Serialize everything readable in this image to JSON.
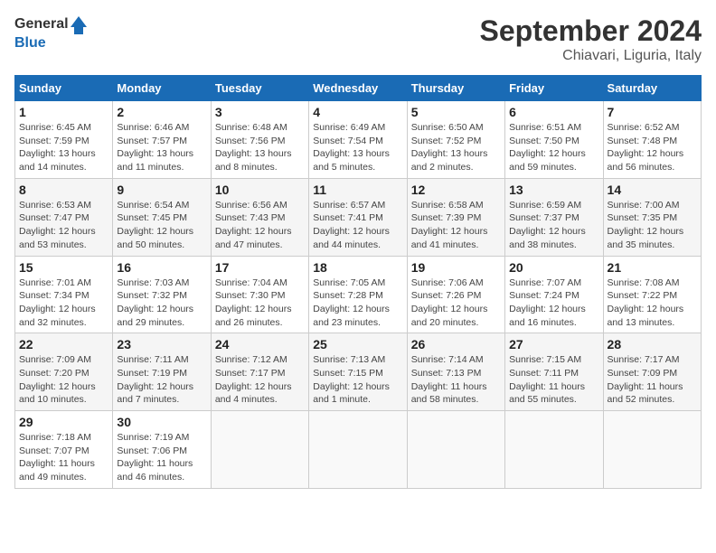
{
  "logo": {
    "line1": "General",
    "line2": "Blue"
  },
  "title": "September 2024",
  "location": "Chiavari, Liguria, Italy",
  "weekdays": [
    "Sunday",
    "Monday",
    "Tuesday",
    "Wednesday",
    "Thursday",
    "Friday",
    "Saturday"
  ],
  "weeks": [
    [
      {
        "day": "1",
        "info": "Sunrise: 6:45 AM\nSunset: 7:59 PM\nDaylight: 13 hours\nand 14 minutes."
      },
      {
        "day": "2",
        "info": "Sunrise: 6:46 AM\nSunset: 7:57 PM\nDaylight: 13 hours\nand 11 minutes."
      },
      {
        "day": "3",
        "info": "Sunrise: 6:48 AM\nSunset: 7:56 PM\nDaylight: 13 hours\nand 8 minutes."
      },
      {
        "day": "4",
        "info": "Sunrise: 6:49 AM\nSunset: 7:54 PM\nDaylight: 13 hours\nand 5 minutes."
      },
      {
        "day": "5",
        "info": "Sunrise: 6:50 AM\nSunset: 7:52 PM\nDaylight: 13 hours\nand 2 minutes."
      },
      {
        "day": "6",
        "info": "Sunrise: 6:51 AM\nSunset: 7:50 PM\nDaylight: 12 hours\nand 59 minutes."
      },
      {
        "day": "7",
        "info": "Sunrise: 6:52 AM\nSunset: 7:48 PM\nDaylight: 12 hours\nand 56 minutes."
      }
    ],
    [
      {
        "day": "8",
        "info": "Sunrise: 6:53 AM\nSunset: 7:47 PM\nDaylight: 12 hours\nand 53 minutes."
      },
      {
        "day": "9",
        "info": "Sunrise: 6:54 AM\nSunset: 7:45 PM\nDaylight: 12 hours\nand 50 minutes."
      },
      {
        "day": "10",
        "info": "Sunrise: 6:56 AM\nSunset: 7:43 PM\nDaylight: 12 hours\nand 47 minutes."
      },
      {
        "day": "11",
        "info": "Sunrise: 6:57 AM\nSunset: 7:41 PM\nDaylight: 12 hours\nand 44 minutes."
      },
      {
        "day": "12",
        "info": "Sunrise: 6:58 AM\nSunset: 7:39 PM\nDaylight: 12 hours\nand 41 minutes."
      },
      {
        "day": "13",
        "info": "Sunrise: 6:59 AM\nSunset: 7:37 PM\nDaylight: 12 hours\nand 38 minutes."
      },
      {
        "day": "14",
        "info": "Sunrise: 7:00 AM\nSunset: 7:35 PM\nDaylight: 12 hours\nand 35 minutes."
      }
    ],
    [
      {
        "day": "15",
        "info": "Sunrise: 7:01 AM\nSunset: 7:34 PM\nDaylight: 12 hours\nand 32 minutes."
      },
      {
        "day": "16",
        "info": "Sunrise: 7:03 AM\nSunset: 7:32 PM\nDaylight: 12 hours\nand 29 minutes."
      },
      {
        "day": "17",
        "info": "Sunrise: 7:04 AM\nSunset: 7:30 PM\nDaylight: 12 hours\nand 26 minutes."
      },
      {
        "day": "18",
        "info": "Sunrise: 7:05 AM\nSunset: 7:28 PM\nDaylight: 12 hours\nand 23 minutes."
      },
      {
        "day": "19",
        "info": "Sunrise: 7:06 AM\nSunset: 7:26 PM\nDaylight: 12 hours\nand 20 minutes."
      },
      {
        "day": "20",
        "info": "Sunrise: 7:07 AM\nSunset: 7:24 PM\nDaylight: 12 hours\nand 16 minutes."
      },
      {
        "day": "21",
        "info": "Sunrise: 7:08 AM\nSunset: 7:22 PM\nDaylight: 12 hours\nand 13 minutes."
      }
    ],
    [
      {
        "day": "22",
        "info": "Sunrise: 7:09 AM\nSunset: 7:20 PM\nDaylight: 12 hours\nand 10 minutes."
      },
      {
        "day": "23",
        "info": "Sunrise: 7:11 AM\nSunset: 7:19 PM\nDaylight: 12 hours\nand 7 minutes."
      },
      {
        "day": "24",
        "info": "Sunrise: 7:12 AM\nSunset: 7:17 PM\nDaylight: 12 hours\nand 4 minutes."
      },
      {
        "day": "25",
        "info": "Sunrise: 7:13 AM\nSunset: 7:15 PM\nDaylight: 12 hours\nand 1 minute."
      },
      {
        "day": "26",
        "info": "Sunrise: 7:14 AM\nSunset: 7:13 PM\nDaylight: 11 hours\nand 58 minutes."
      },
      {
        "day": "27",
        "info": "Sunrise: 7:15 AM\nSunset: 7:11 PM\nDaylight: 11 hours\nand 55 minutes."
      },
      {
        "day": "28",
        "info": "Sunrise: 7:17 AM\nSunset: 7:09 PM\nDaylight: 11 hours\nand 52 minutes."
      }
    ],
    [
      {
        "day": "29",
        "info": "Sunrise: 7:18 AM\nSunset: 7:07 PM\nDaylight: 11 hours\nand 49 minutes."
      },
      {
        "day": "30",
        "info": "Sunrise: 7:19 AM\nSunset: 7:06 PM\nDaylight: 11 hours\nand 46 minutes."
      },
      null,
      null,
      null,
      null,
      null
    ]
  ]
}
